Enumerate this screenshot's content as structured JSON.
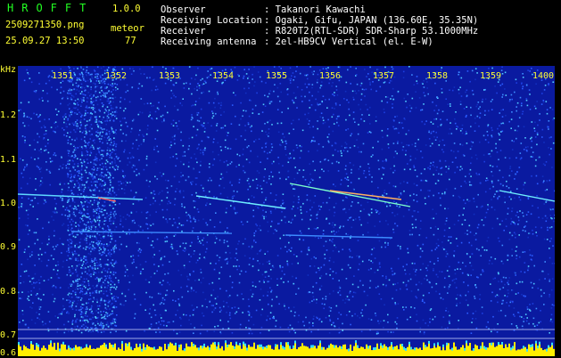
{
  "header": {
    "app_title": "HROFFT",
    "version": "1.0.0",
    "filename": "2509271350.png",
    "event_label": "meteor",
    "timestamp": "25.09.27 13:50",
    "event_count": "77",
    "info": [
      {
        "label": "Observer",
        "value": ": Takanori Kawachi"
      },
      {
        "label": "Receiving Location",
        "value": ": Ogaki, Gifu, JAPAN (136.60E, 35.35N)"
      },
      {
        "label": "Receiver",
        "value": ": R820T2(RTL-SDR) SDR-Sharp 53.1000MHz"
      },
      {
        "label": "Receiving antenna",
        "value": ": 2el-HB9CV Vertical (el. E-W)"
      }
    ]
  },
  "axes": {
    "y_unit": "kHz",
    "y_ticks": [
      "1.2",
      "1.1",
      "1.0",
      "0.9",
      "0.8",
      "0.7",
      "0.6"
    ],
    "x_ticks": [
      "1351",
      "1352",
      "1353",
      "1354",
      "1355",
      "1356",
      "1357",
      "1358",
      "1359",
      "1400"
    ]
  },
  "colors": {
    "background": "#000000",
    "spectrogram_base": "#0a1aa0",
    "text_yellow": "#ffff33",
    "text_white": "#ffffff",
    "text_green": "#22ff22"
  }
}
